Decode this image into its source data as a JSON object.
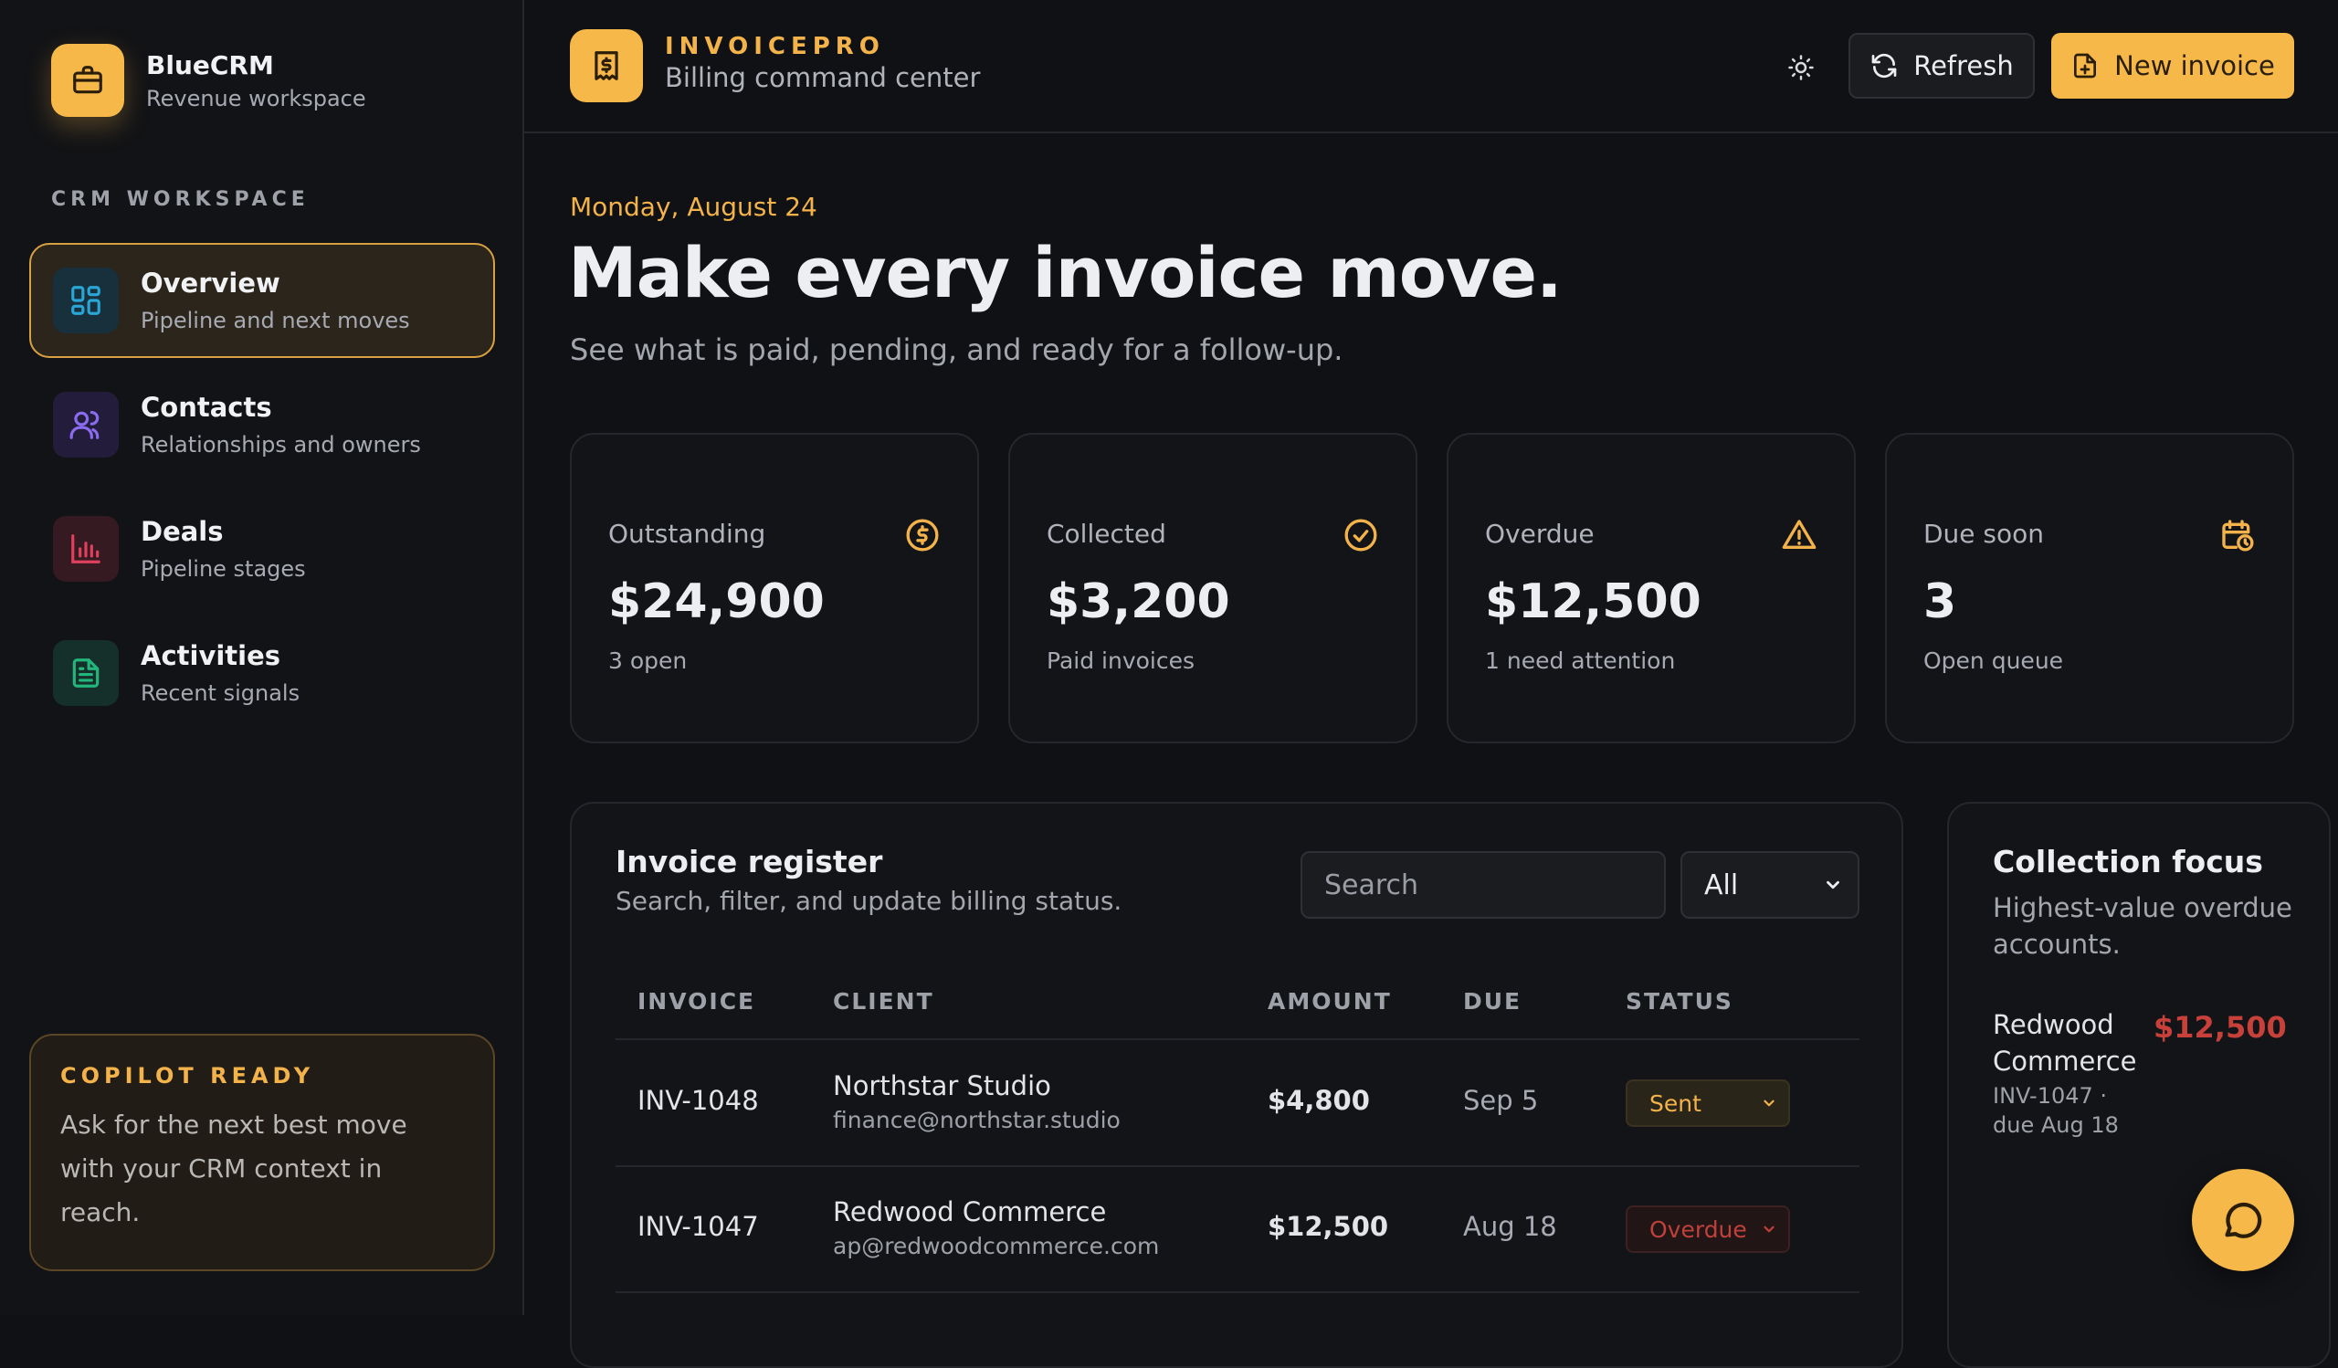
{
  "sidebar": {
    "brand_name": "BlueCRM",
    "brand_sub": "Revenue workspace",
    "section_label": "CRM WORKSPACE",
    "items": [
      {
        "title": "Overview",
        "sub": "Pipeline and next moves",
        "icon": "grid-icon",
        "color": "#2aa6d6"
      },
      {
        "title": "Contacts",
        "sub": "Relationships and owners",
        "icon": "users-icon",
        "color": "#8b6cf0"
      },
      {
        "title": "Deals",
        "sub": "Pipeline stages",
        "icon": "bar-chart-icon",
        "color": "#e0405e"
      },
      {
        "title": "Activities",
        "sub": "Recent signals",
        "icon": "document-icon",
        "color": "#22b57c"
      }
    ],
    "copilot_title": "COPILOT READY",
    "copilot_body": "Ask for the next best move with your CRM context in reach."
  },
  "topbar": {
    "app_name": "INVOICEPRO",
    "app_sub": "Billing command center",
    "refresh_label": "Refresh",
    "new_label": "New invoice"
  },
  "hero": {
    "date": "Monday, August 24",
    "headline": "Make every invoice move.",
    "subline": "See what is paid, pending, and ready for a follow-up."
  },
  "stats": [
    {
      "label": "Outstanding",
      "value": "$24,900",
      "sub": "3 open",
      "icon": "dollar-circle-icon"
    },
    {
      "label": "Collected",
      "value": "$3,200",
      "sub": "Paid invoices",
      "icon": "check-circle-icon"
    },
    {
      "label": "Overdue",
      "value": "$12,500",
      "sub": "1 need attention",
      "icon": "warning-icon"
    },
    {
      "label": "Due soon",
      "value": "3",
      "sub": "Open queue",
      "icon": "calendar-clock-icon"
    }
  ],
  "register": {
    "title": "Invoice register",
    "sub": "Search, filter, and update billing status.",
    "search_placeholder": "Search",
    "filter_value": "All",
    "columns": [
      "INVOICE",
      "CLIENT",
      "AMOUNT",
      "DUE",
      "STATUS"
    ],
    "rows": [
      {
        "invoice": "INV-1048",
        "client": "Northstar Studio",
        "email": "finance@northstar.studio",
        "amount": "$4,800",
        "due": "Sep 5",
        "status": "Sent"
      },
      {
        "invoice": "INV-1047",
        "client": "Redwood Commerce",
        "email": "ap@redwoodcommerce.com",
        "amount": "$12,500",
        "due": "Aug 18",
        "status": "Overdue"
      }
    ]
  },
  "focus": {
    "title": "Collection focus",
    "sub": "Highest-value overdue accounts.",
    "account_name": "Redwood Commerce",
    "account_amount": "$12,500",
    "account_meta": "INV-1047 · due Aug 18"
  },
  "colors": {
    "accent": "#f7b84a",
    "danger": "#c7403a",
    "background": "#101114"
  }
}
